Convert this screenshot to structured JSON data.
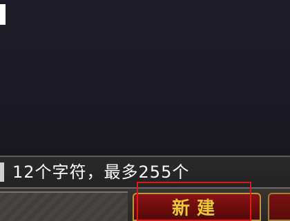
{
  "hint": {
    "text": "12个字符，最多255个"
  },
  "buttons": {
    "new_label": "新建"
  },
  "colors": {
    "button_red": "#7a1010",
    "button_text_gold": "#f2c531",
    "highlight_red": "#e01818"
  }
}
